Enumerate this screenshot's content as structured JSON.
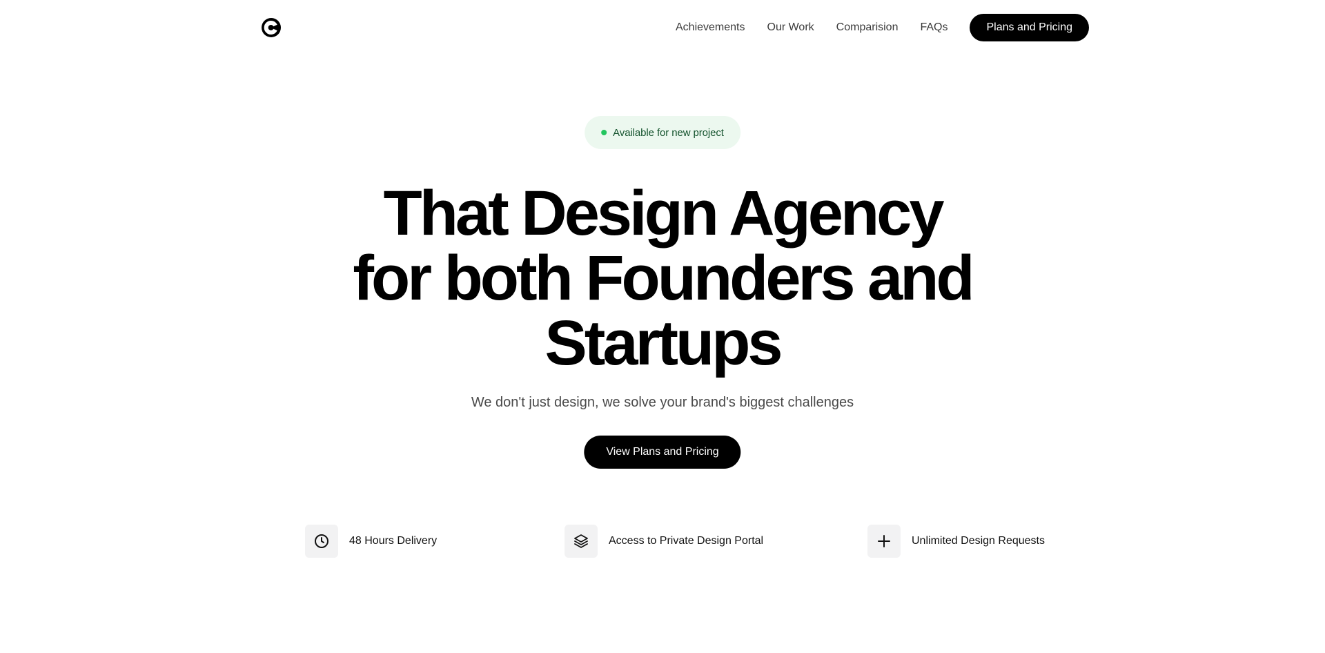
{
  "header": {
    "logo_name": "brand-logo",
    "nav": [
      {
        "label": "Achievements"
      },
      {
        "label": "Our Work"
      },
      {
        "label": "Comparision"
      },
      {
        "label": "FAQs"
      }
    ],
    "cta_label": "Plans and Pricing"
  },
  "badge": {
    "text": "Available for new project",
    "dot_color": "#22c55e"
  },
  "hero": {
    "title_lines": [
      "That Design Agency",
      "for both Founders and",
      "Startups"
    ],
    "subtitle": "We don't just design, we solve your brand's biggest challenges",
    "cta_label": "View Plans and Pricing"
  },
  "features": [
    {
      "icon": "clock-icon",
      "label": "48 Hours Delivery"
    },
    {
      "icon": "layers-icon",
      "label": "Access to Private Design Portal"
    },
    {
      "icon": "plus-icon",
      "label": "Unlimited Design Requests"
    }
  ],
  "colors": {
    "primary": "#000000",
    "badge_bg": "#ecf8ef",
    "badge_text": "#14532d",
    "icon_tile_bg": "#f2f2f3"
  }
}
